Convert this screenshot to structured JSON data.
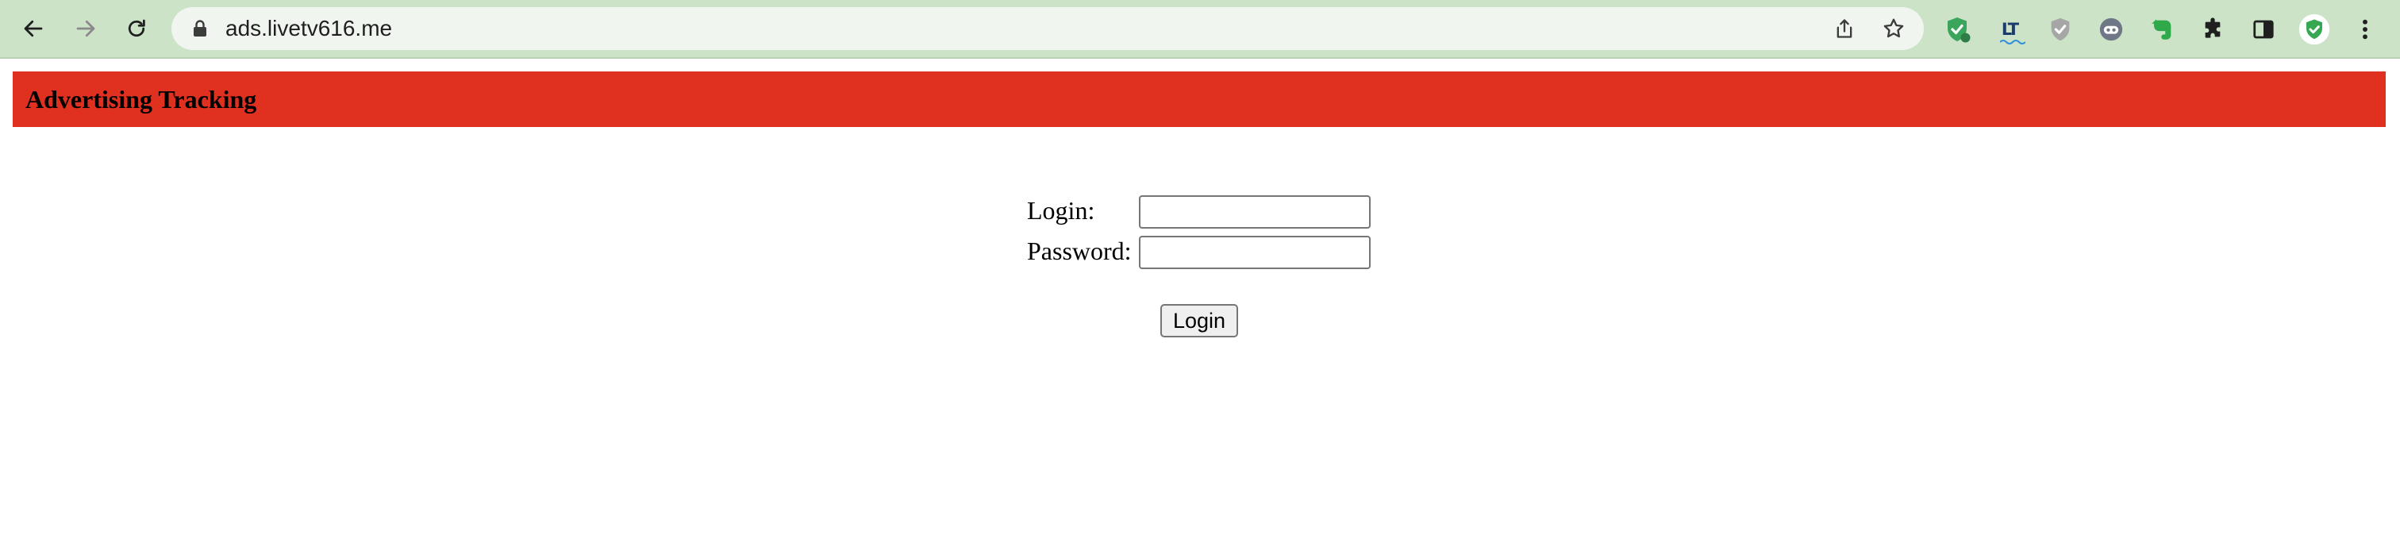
{
  "browser": {
    "url": "ads.livetv616.me",
    "extensions": [
      "shield-check-icon",
      "lt-icon",
      "gray-shield-icon",
      "robot-icon",
      "evernote-icon",
      "puzzle-icon",
      "side-panel-icon",
      "profile-icon",
      "menu-icon"
    ],
    "colors": {
      "toolbar": "#cce3c8",
      "omnibox": "#f0f6ef",
      "banner": "#e03020"
    }
  },
  "page": {
    "title": "Advertising Tracking",
    "form": {
      "login_label": "Login:",
      "password_label": "Password:",
      "login_value": "",
      "password_value": "",
      "submit_label": "Login"
    }
  }
}
